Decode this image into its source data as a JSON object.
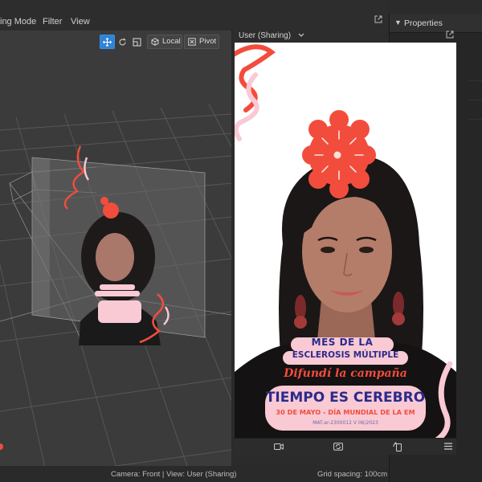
{
  "menubar": {
    "items": [
      "ing Mode",
      "Filter",
      "View"
    ]
  },
  "properties_panel": {
    "title": "Properties"
  },
  "viewport_toolbar": {
    "local_label": "Local",
    "pivot_label": "Pivot"
  },
  "preview": {
    "title": "User (Sharing)",
    "overlay": {
      "line1": "MES DE LA",
      "line2": "ESCLEROSIS MÚLTIPLE",
      "line3": "Difundí la campaña",
      "line4": "TIEMPO ES CEREBRO",
      "line5": "30 DE MAYO - DÍA MUNDIAL DE LA EM",
      "line6": "MAT-ar-2300012 V 06/2023"
    }
  },
  "statusbar": {
    "camera": "Camera: Front | View: User (Sharing)",
    "grid": "Grid spacing: 100cm"
  },
  "colors": {
    "accent_coral": "#f24c3d",
    "accent_pink": "#f9c9d4",
    "selection_blue": "#2f84d6"
  },
  "icons": [
    "move-icon",
    "rotate-icon",
    "scale-icon",
    "cube-icon",
    "close-box-icon",
    "external-link-icon",
    "chevron-down-icon",
    "video-icon",
    "camera-switch-icon",
    "rotate-device-icon",
    "menu-icon"
  ]
}
